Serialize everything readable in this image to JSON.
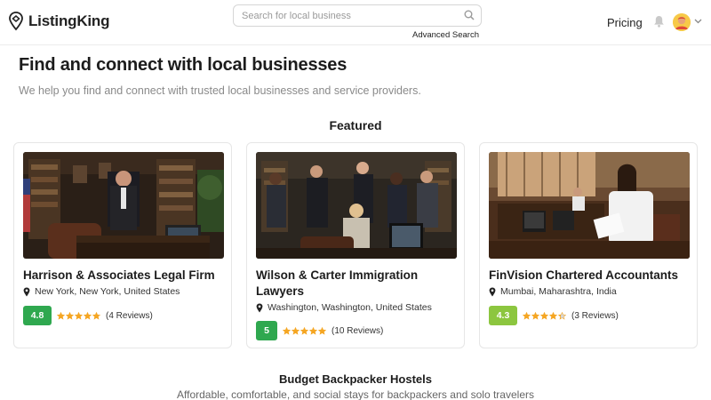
{
  "header": {
    "brand": "ListingKing",
    "search_placeholder": "Search for local business",
    "advanced_search": "Advanced Search",
    "pricing": "Pricing"
  },
  "hero": {
    "title": "Find and connect with local businesses",
    "subtitle": "We help you find and connect with trusted local businesses and service providers."
  },
  "featured": {
    "heading": "Featured",
    "listings": [
      {
        "title": "Harrison & Associates Legal Firm",
        "location": "New York, New York, United States",
        "rating": "4.8",
        "rating_value": 4.8,
        "badge_color": "#2fa84f",
        "reviews": "(4 Reviews)"
      },
      {
        "title": "Wilson & Carter Immigration Lawyers",
        "location": "Washington, Washington, United States",
        "rating": "5",
        "rating_value": 5,
        "badge_color": "#2fa84f",
        "reviews": "(10 Reviews)"
      },
      {
        "title": "FinVision Chartered Accountants",
        "location": "Mumbai, Maharashtra, India",
        "rating": "4.3",
        "rating_value": 4.3,
        "badge_color": "#8cc63f",
        "reviews": "(3 Reviews)"
      }
    ]
  },
  "section2": {
    "title": "Budget Backpacker Hostels",
    "subtitle": "Affordable, comfortable, and social stays for backpackers and solo travelers"
  },
  "colors": {
    "star": "#f5a623",
    "accent_green": "#2fa84f",
    "accent_light_green": "#8cc63f"
  }
}
